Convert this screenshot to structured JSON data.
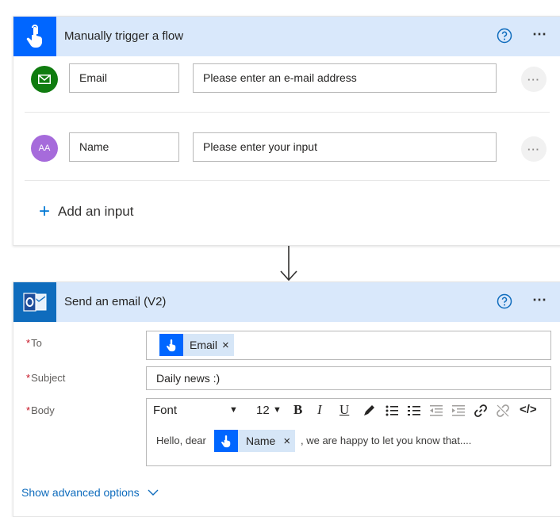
{
  "trigger": {
    "title": "Manually trigger a flow",
    "inputs": [
      {
        "name": "Email",
        "placeholder": "Please enter an e-mail address"
      },
      {
        "name": "Name",
        "placeholder": "Please enter your input"
      }
    ],
    "avatar_text": "AA",
    "add_input_label": "Add an input",
    "more_label": "⋯",
    "ellipsis_label": "···"
  },
  "action": {
    "title": "Send an email (V2)",
    "to_label": "To",
    "to_token": "Email",
    "subject_label": "Subject",
    "subject_value": "Daily news :)",
    "body_label": "Body",
    "font_label": "Font",
    "font_size": "12",
    "bold": "B",
    "italic": "I",
    "underline": "U",
    "code": "</>",
    "body_prefix": "Hello, dear",
    "body_token": "Name",
    "body_suffix": ", we are happy to let you know that....",
    "token_remove": "×",
    "required_mark": "*",
    "advanced_label": "Show advanced options"
  },
  "colors": {
    "header_bg": "#d9e8fb",
    "trigger_accent": "#0066ff",
    "email_avatar": "#107c10",
    "name_avatar": "#a66bdb",
    "link": "#0f6cbd"
  }
}
